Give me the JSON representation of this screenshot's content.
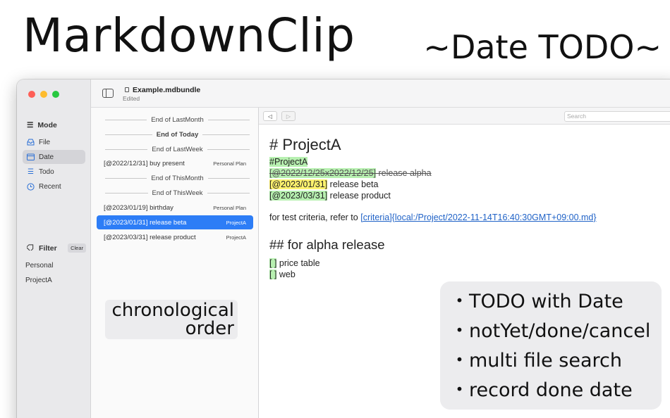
{
  "hero": {
    "title": "MarkdownClip",
    "subtitle": "~Date TODO~"
  },
  "toolbar": {
    "doc_title": "Example.mdbundle",
    "doc_status": "Edited"
  },
  "sidebar": {
    "mode_label": "Mode",
    "mode_items": [
      {
        "label": "File",
        "icon": "tray-icon"
      },
      {
        "label": "Date",
        "icon": "calendar-icon",
        "selected": true
      },
      {
        "label": "Todo",
        "icon": "list-icon"
      },
      {
        "label": "Recent",
        "icon": "clock-icon"
      }
    ],
    "filter_label": "Filter",
    "clear_label": "Clear",
    "filters": [
      "Personal",
      "ProjectA"
    ]
  },
  "list": {
    "entries": [
      {
        "kind": "separator",
        "text": "End of LastMonth"
      },
      {
        "kind": "separator",
        "text": "End of Today",
        "bold": true
      },
      {
        "kind": "separator",
        "text": "End of LastWeek"
      },
      {
        "kind": "item",
        "text": "[@2022/12/31] buy present",
        "tag": "Personal Plan"
      },
      {
        "kind": "separator",
        "text": "End of ThisMonth"
      },
      {
        "kind": "separator",
        "text": "End of ThisWeek"
      },
      {
        "kind": "item",
        "text": "[@2023/01/19] birthday",
        "tag": "Personal Plan"
      },
      {
        "kind": "item",
        "text": "[@2023/01/31] release beta",
        "tag": "ProjectA",
        "selected": true
      },
      {
        "kind": "item",
        "text": "[@2023/03/31] release product",
        "tag": "ProjectA"
      }
    ]
  },
  "caption": {
    "line1": "chronological",
    "line2": "order"
  },
  "search": {
    "placeholder": "Search"
  },
  "nav": {
    "back": "◁",
    "forward": "▷"
  },
  "editor": {
    "h1": "# ProjectA",
    "tag_line": "#ProjectA",
    "todo1_date": "[@2022/12/25x2022/12/25]",
    "todo1_text": " release alpha",
    "todo2_date": "[@2023/01/31]",
    "todo2_text": " release beta",
    "todo3_date": "[@2023/03/31]",
    "todo3_text": " release product",
    "criteria_text": "for test criteria, refer to ",
    "criteria_link": "[criteria]{local:/Project/2022-11-14T16:40:30GMT+09:00.md}",
    "h2": "## for alpha release",
    "check1_box": "[ ]",
    "check1_text": " price table",
    "check2_box": "[ ]",
    "check2_text": " web"
  },
  "features": [
    "・TODO with Date",
    "・notYet/done/cancel",
    "・multi file search",
    "・record done date"
  ],
  "colors": {
    "selection": "#2d7df6",
    "done_highlight": "#b7f0b0",
    "pending_highlight": "#fff36e",
    "link": "#1f62c7"
  }
}
